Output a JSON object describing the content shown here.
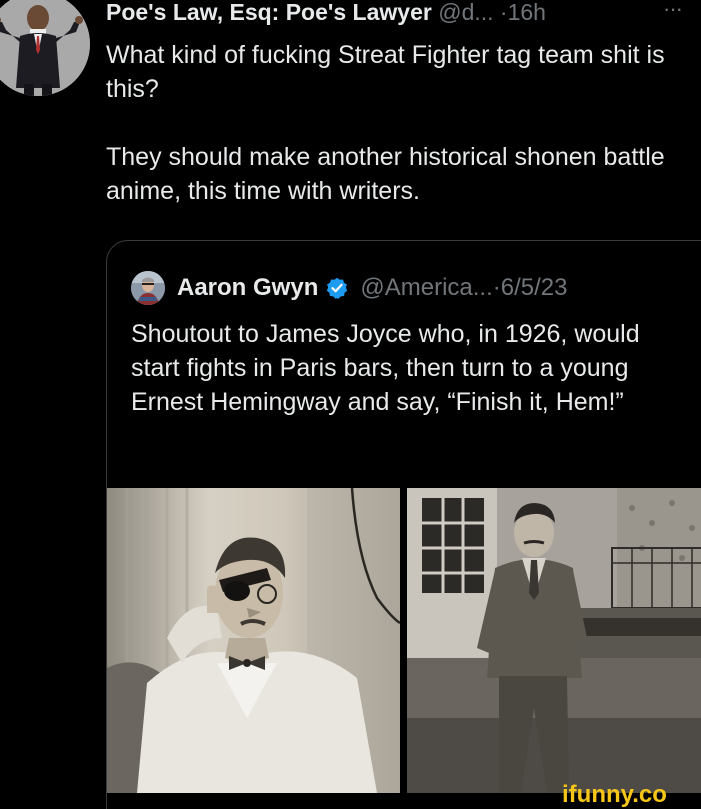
{
  "tweet": {
    "author_name": "Poe's Law, Esq: Poe's Lawyer",
    "handle": "@d...",
    "separator": "·",
    "time": "16h",
    "more": "···",
    "paragraphs": [
      "What kind of fucking Streat Fighter tag team shit is this?",
      "They should make another historical shonen battle anime, this time with writers."
    ]
  },
  "quote": {
    "author_name": "Aaron Gwyn",
    "handle": "@America...",
    "separator": "·",
    "date": "6/5/23",
    "text": "Shoutout to James Joyce who, in 1926, would start fights in Paris bars, then turn to a young Ernest Hemingway and say, “Finish it, Hem!”",
    "verified_color": "#1d9bf0"
  },
  "watermark": {
    "text": "ifunny.co",
    "color": "#f5c518"
  },
  "icons": {
    "more": "more-icon",
    "verified": "verified-badge-icon"
  }
}
